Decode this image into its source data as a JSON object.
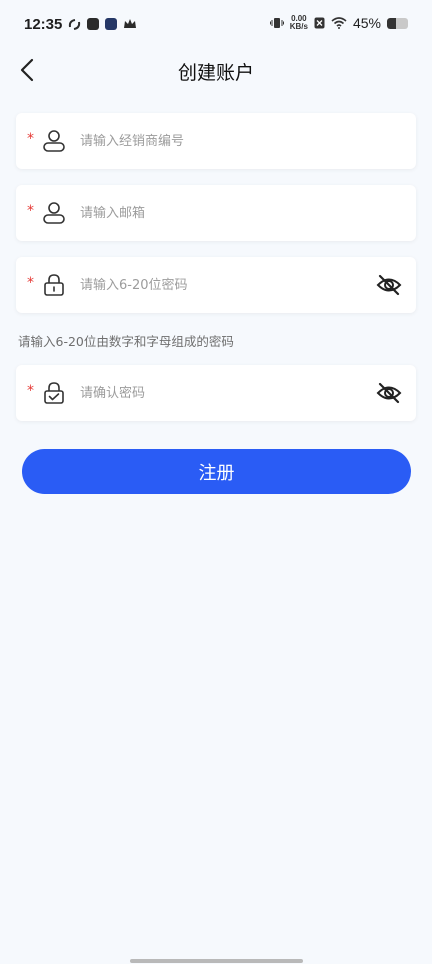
{
  "status_bar": {
    "time": "12:35",
    "net_speed_value": "0.00",
    "net_speed_unit": "KB/s",
    "battery_percent_text": "45%",
    "battery_level": 0.45
  },
  "header": {
    "title": "创建账户",
    "back_icon": "chevron-left-icon"
  },
  "form": {
    "dealer_code": {
      "required_mark": "*",
      "placeholder": "请输入经销商编号",
      "icon": "user-icon"
    },
    "email": {
      "required_mark": "*",
      "placeholder": "请输入邮箱",
      "icon": "user-icon"
    },
    "password": {
      "required_mark": "*",
      "placeholder": "请输入6-20位密码",
      "icon": "lock-icon",
      "toggle_icon": "eye-off-icon"
    },
    "password_hint": "请输入6-20位由数字和字母组成的密码",
    "confirm_password": {
      "required_mark": "*",
      "placeholder": "请确认密码",
      "icon": "lock-check-icon",
      "toggle_icon": "eye-off-icon"
    }
  },
  "actions": {
    "register_label": "注册"
  },
  "colors": {
    "primary": "#2a5cf5",
    "required": "#e53935",
    "background": "#f6f9fd"
  }
}
